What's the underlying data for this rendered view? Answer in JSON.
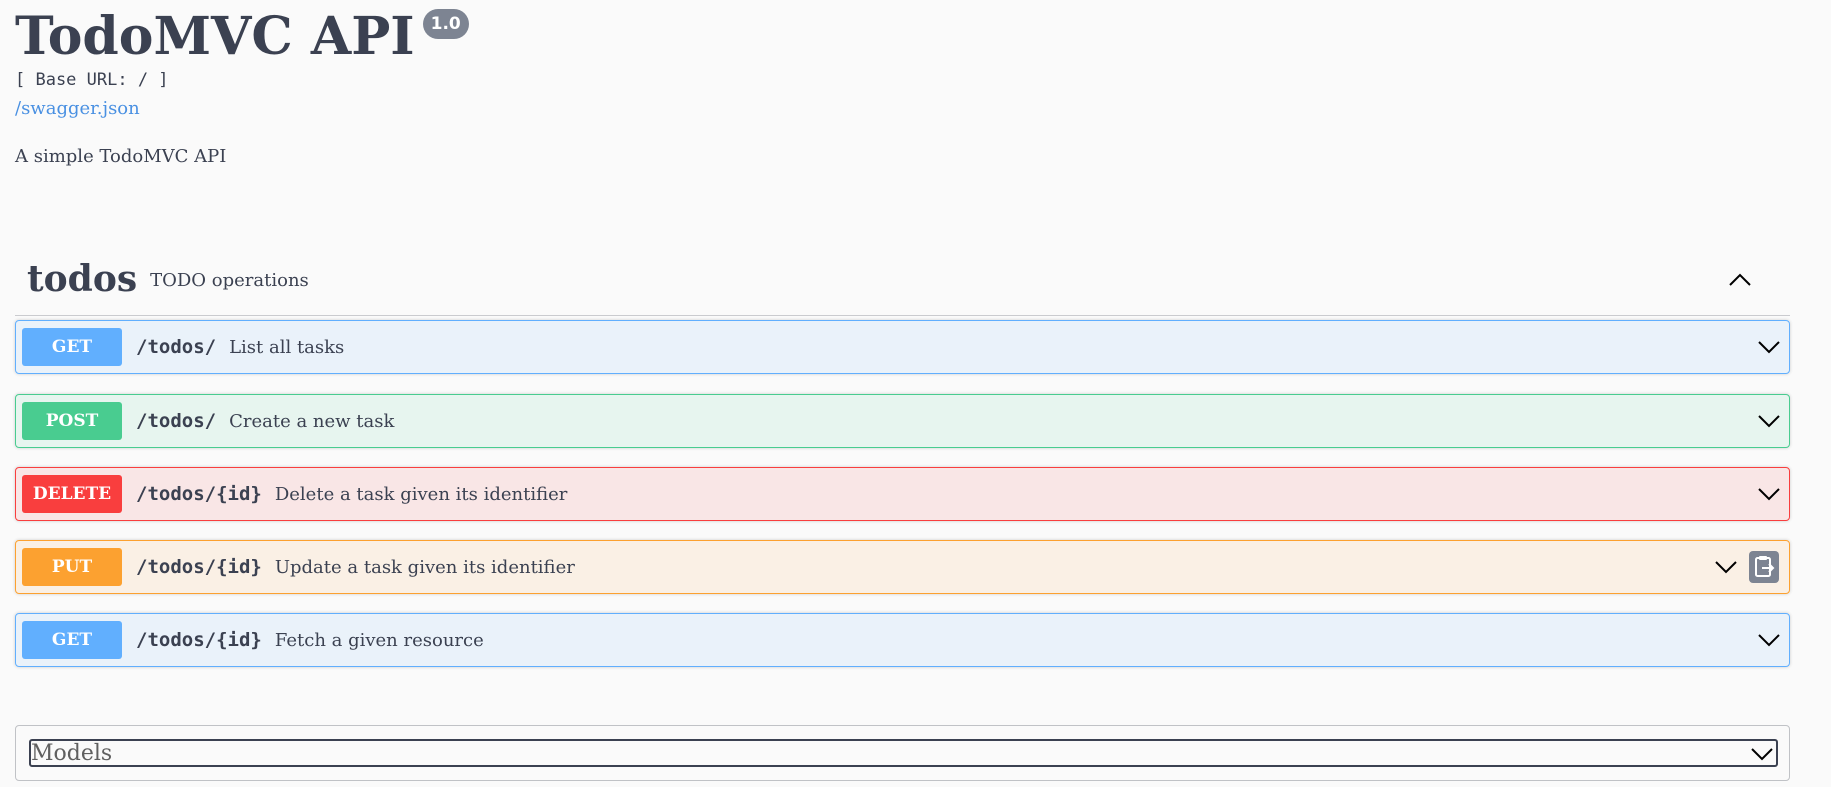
{
  "info": {
    "title": "TodoMVC API",
    "version": "1.0",
    "base_url": "[ Base URL: / ]",
    "spec_link": "/swagger.json",
    "description": "A simple TodoMVC API"
  },
  "tag": {
    "name": "todos",
    "description": "TODO operations",
    "expanded": true
  },
  "operations": [
    {
      "method": "GET",
      "path": "/todos/",
      "summary": "List all tasks"
    },
    {
      "method": "POST",
      "path": "/todos/",
      "summary": "Create a new task"
    },
    {
      "method": "DELETE",
      "path": "/todos/{id}",
      "summary": "Delete a task given its identifier"
    },
    {
      "method": "PUT",
      "path": "/todos/{id}",
      "summary": "Update a task given its identifier"
    },
    {
      "method": "GET",
      "path": "/todos/{id}",
      "summary": "Fetch a given resource"
    }
  ],
  "models": {
    "label": "Models"
  },
  "colors": {
    "get": "#61affe",
    "post": "#49cc90",
    "delete": "#f93e3e",
    "put": "#fca130",
    "link": "#4990e2",
    "text": "#3b4151"
  },
  "icons": {
    "expand": "chevron-down-icon",
    "collapse": "chevron-up-icon",
    "copy": "clipboard-icon"
  }
}
